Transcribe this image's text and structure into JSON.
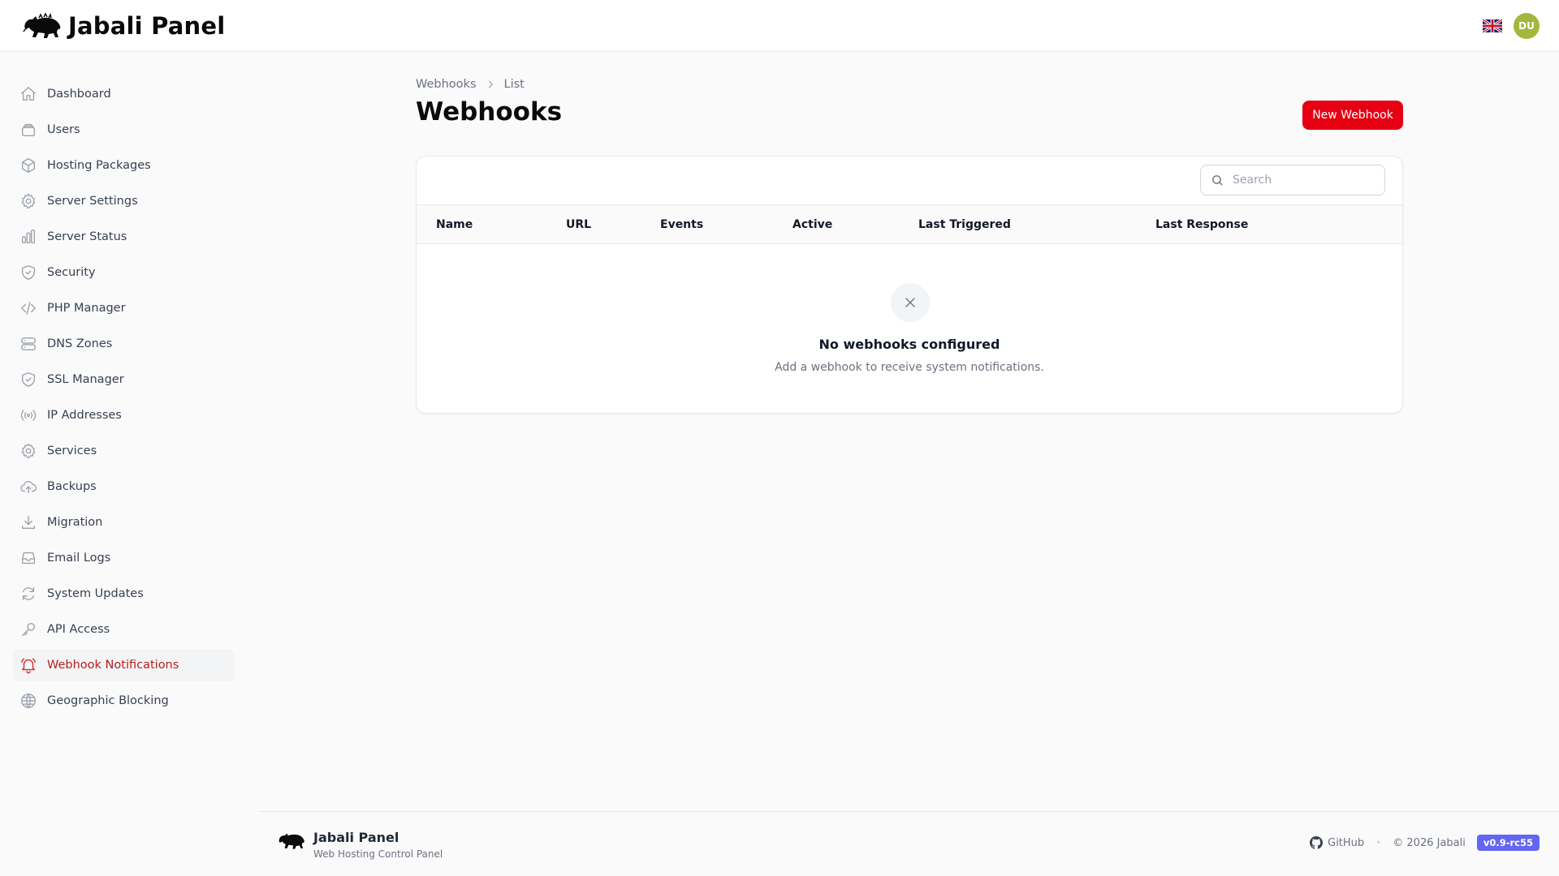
{
  "app": {
    "name": "Jabali Panel",
    "tagline": "Web Hosting Control Panel"
  },
  "header": {
    "avatar_initials": "DU",
    "language_flag": "uk-flag-icon"
  },
  "sidebar": {
    "items": [
      {
        "label": "Dashboard",
        "icon": "home-icon"
      },
      {
        "label": "Users",
        "icon": "users-icon"
      },
      {
        "label": "Hosting Packages",
        "icon": "cube-icon"
      },
      {
        "label": "Server Settings",
        "icon": "gear-icon"
      },
      {
        "label": "Server Status",
        "icon": "chart-bar-icon"
      },
      {
        "label": "Security",
        "icon": "shield-icon"
      },
      {
        "label": "PHP Manager",
        "icon": "code-icon"
      },
      {
        "label": "DNS Zones",
        "icon": "server-icon"
      },
      {
        "label": "SSL Manager",
        "icon": "shield-check-icon"
      },
      {
        "label": "IP Addresses",
        "icon": "signal-icon"
      },
      {
        "label": "Services",
        "icon": "cog-icon"
      },
      {
        "label": "Backups",
        "icon": "cloud-upload-icon"
      },
      {
        "label": "Migration",
        "icon": "download-icon"
      },
      {
        "label": "Email Logs",
        "icon": "inbox-icon"
      },
      {
        "label": "System Updates",
        "icon": "refresh-icon"
      },
      {
        "label": "API Access",
        "icon": "key-icon"
      },
      {
        "label": "Webhook Notifications",
        "icon": "bell-icon"
      },
      {
        "label": "Geographic Blocking",
        "icon": "globe-icon"
      }
    ],
    "active_index": 16
  },
  "breadcrumb": {
    "parent": "Webhooks",
    "current": "List"
  },
  "page": {
    "title": "Webhooks",
    "new_button": "New Webhook"
  },
  "table": {
    "search_placeholder": "Search",
    "columns": [
      "Name",
      "URL",
      "Events",
      "Active",
      "Last Triggered",
      "Last Response"
    ],
    "empty_title": "No webhooks configured",
    "empty_description": "Add a webhook to receive system notifications."
  },
  "footer": {
    "github_label": "GitHub",
    "copyright": "© 2026 Jabali",
    "version": "v0.9-rc55"
  },
  "colors": {
    "accent": "#e60012",
    "active_text": "#b91c1c",
    "version_badge": "#6366f1",
    "avatar": "#a3b73d"
  }
}
